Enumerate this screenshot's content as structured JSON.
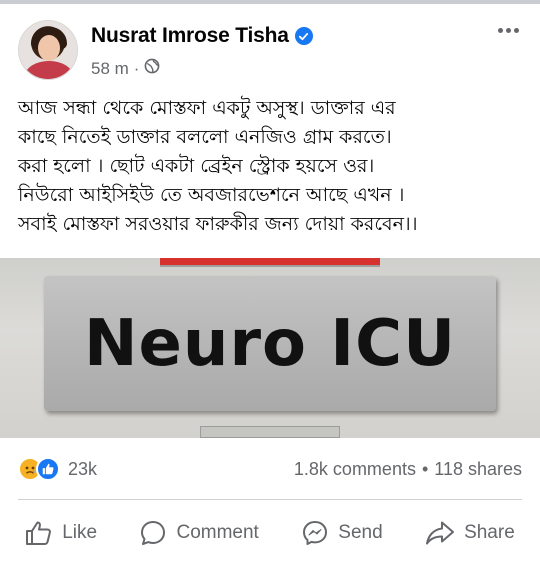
{
  "post": {
    "author_name": "Nusrat Imrose Tisha",
    "time": "58 m",
    "separator": "·",
    "audience_icon": "globe-icon",
    "text_lines": [
      "আজ সন্ধা থেকে মোস্তফা একটু অসুস্থ। ডাক্তার এর",
      "কাছে নিতেই ডাক্তার  বললো এনজিও গ্রাম করতে।",
      "করা হলো । ছোট একটা ব্রেইন স্ট্রোক হয়সে ওর।",
      "নিউরো আইসিইউ তে অবজারভেশনে আছে এখন ।",
      "সবাই মোস্তফা সরওয়ার ফারুকীর জন্য দোয়া করবেন।।"
    ],
    "image_sign_text": "Neuro ICU"
  },
  "stats": {
    "reaction_icons": [
      "sad-reaction-icon",
      "like-reaction-icon"
    ],
    "reaction_count": "23k",
    "comments": "1.8k comments",
    "dot": "•",
    "shares": "118 shares"
  },
  "actions": {
    "like_label": "Like",
    "comment_label": "Comment",
    "send_label": "Send",
    "share_label": "Share"
  },
  "colors": {
    "verified_badge": "#1877f2",
    "secondary_text": "#65676b",
    "like_blue": "#1877f2",
    "sad_yellow": "#f7b125"
  }
}
